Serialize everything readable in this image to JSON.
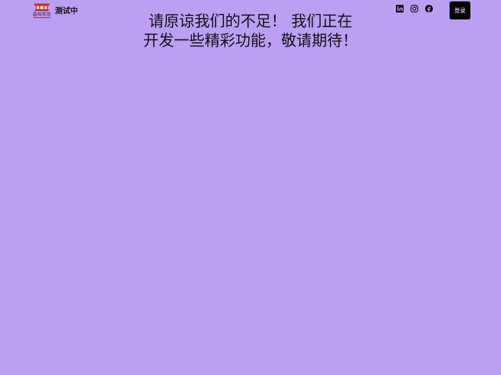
{
  "header": {
    "site_title": "测试中",
    "logo_text": "義興茶號",
    "login_label": "登录",
    "social": [
      {
        "icon": "linkedin-icon"
      },
      {
        "icon": "instagram-icon"
      },
      {
        "icon": "facebook-icon"
      }
    ]
  },
  "main": {
    "message_line1": "请原谅我们的不足！ 我们正在",
    "message_line2": "开发一些精彩功能，敬请期待！"
  },
  "colors": {
    "background": "#bb9ff3",
    "button": "#000000",
    "logo_red": "#c0392b"
  }
}
